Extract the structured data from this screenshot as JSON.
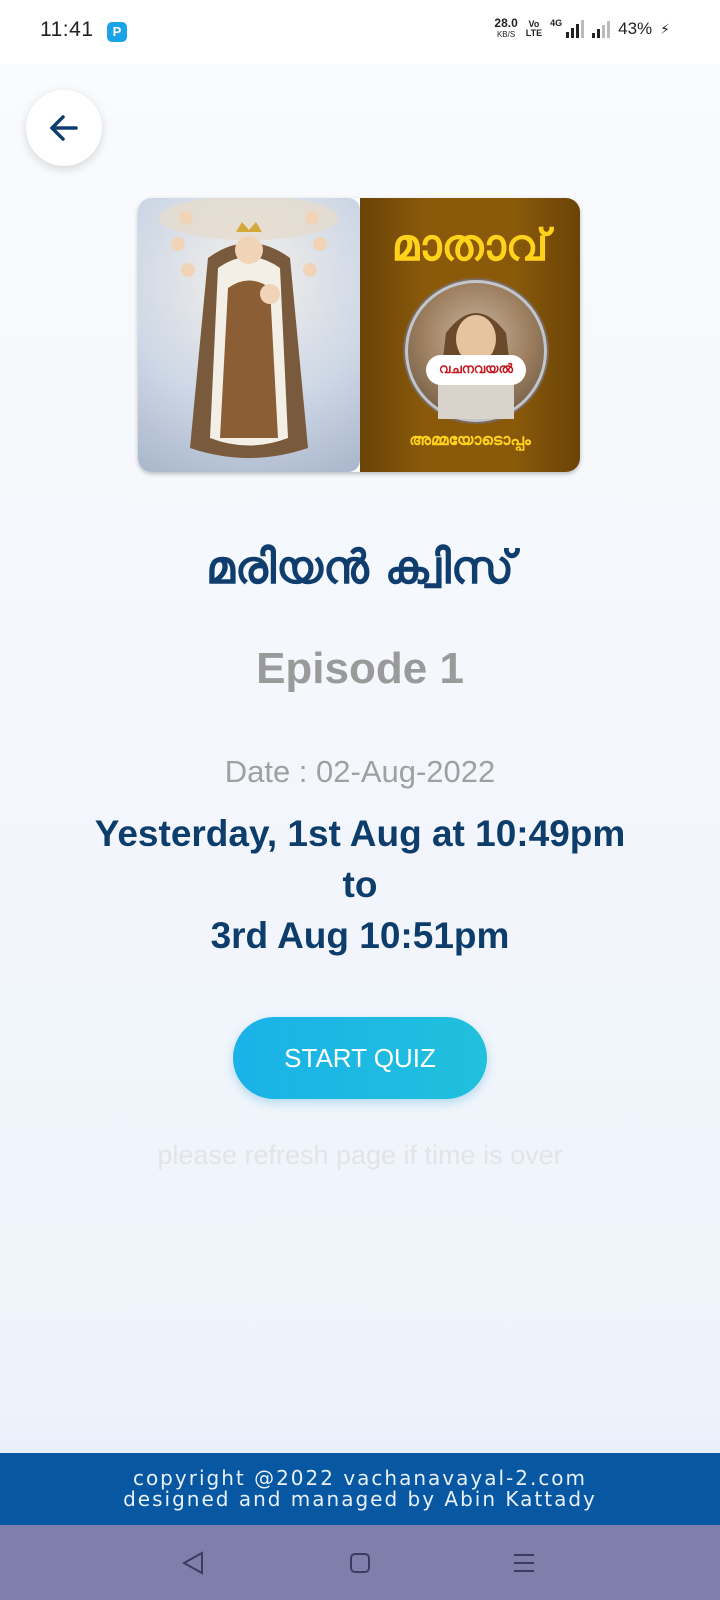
{
  "status_bar": {
    "time": "11:41",
    "app_icon_letter": "P",
    "net_speed": "28.0",
    "net_speed_unit": "KB/S",
    "volte": "Vo\nLTE",
    "net_type": "4G",
    "battery": "43%"
  },
  "back_button": {
    "icon": "arrow-left-icon"
  },
  "banner": {
    "title": "മാതാവ്",
    "medallion_label": "വചനവയൽ",
    "subtitle": "അമ്മയോടൊപ്പം"
  },
  "quiz": {
    "title": "മരിയൻ ക്വിസ്",
    "episode": "Episode 1",
    "date": "Date : 02-Aug-2022",
    "schedule_line1": "Yesterday, 1st Aug at 10:49pm",
    "schedule_line2": "to",
    "schedule_line3": "3rd Aug 10:51pm",
    "start_button": "START QUIZ",
    "refresh_note": "please refresh page if time is over"
  },
  "footer": {
    "line1": "copyright @2022 vachanavayal-2.com",
    "line2": "designed and managed by Abin Kattady"
  },
  "nav_bar": {
    "back": "nav-back-icon",
    "home": "nav-home-icon",
    "menu": "nav-menu-icon"
  },
  "colors": {
    "title": "#0f3e6e",
    "accent_button": "#1ab2e8",
    "footer": "#0757a2",
    "nav_bar": "#7f7fab"
  }
}
